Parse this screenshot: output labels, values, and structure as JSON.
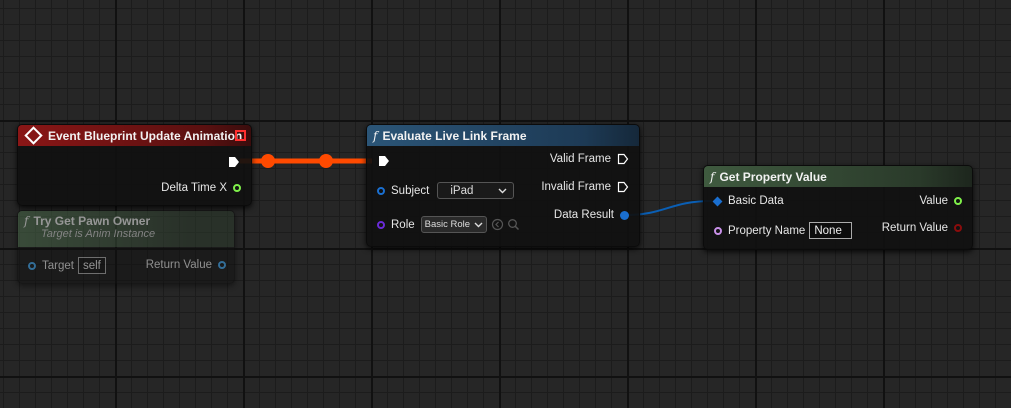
{
  "event_node": {
    "title": "Event Blueprint Update Animation",
    "pin_delta": "Delta Time X"
  },
  "pawn_node": {
    "title": "Try Get Pawn Owner",
    "subtitle": "Target is Anim Instance",
    "target_label": "Target",
    "target_value": "self",
    "return_label": "Return Value"
  },
  "livelink_node": {
    "title": "Evaluate Live Link Frame",
    "subject_label": "Subject",
    "subject_value": "iPad",
    "role_label": "Role",
    "role_value": "Basic Role",
    "valid_label": "Valid Frame",
    "invalid_label": "Invalid Frame",
    "result_label": "Data Result"
  },
  "property_node": {
    "title": "Get Property Value",
    "basic_label": "Basic Data",
    "name_label": "Property Name",
    "name_value": "None",
    "value_label": "Value",
    "return_label": "Return Value"
  },
  "colors": {
    "event_header": "#8a1616",
    "func_header": "#2b5577",
    "pure_header": "#3a5a3a",
    "exec_wire": "#ff4a00",
    "struct_wire": "#0a5fb5"
  }
}
